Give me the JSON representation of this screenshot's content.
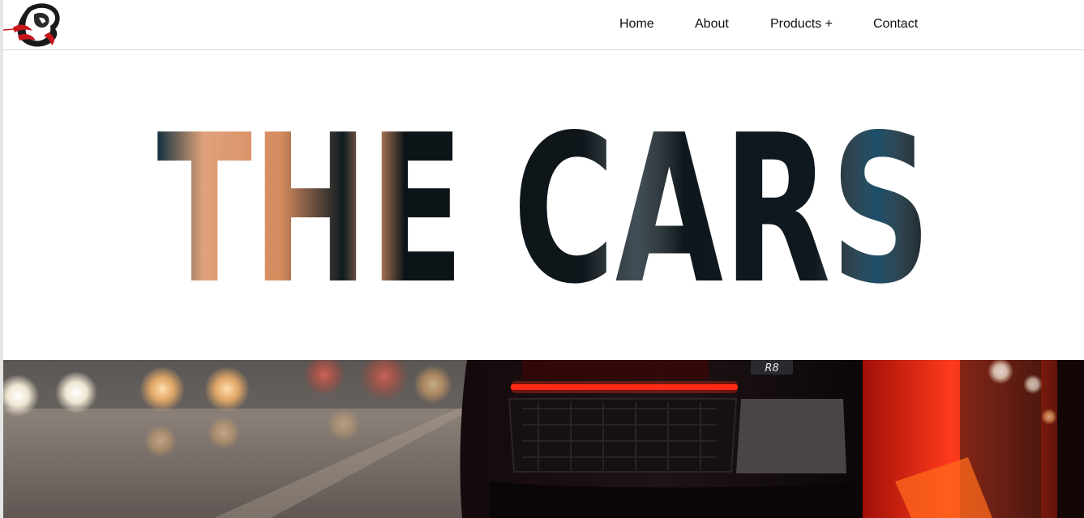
{
  "nav": {
    "items": [
      {
        "label": "Home"
      },
      {
        "label": "About"
      },
      {
        "label": "Products +"
      },
      {
        "label": "Contact"
      }
    ]
  },
  "hero": {
    "title": "THE CARS"
  },
  "banner": {
    "badge_text": "R8"
  },
  "colors": {
    "text": "#111111",
    "divider": "#d4d4d4",
    "hero_fill": "#0f1a20",
    "taillight": "#ff2a14"
  },
  "icons": {
    "logo": "lion-logo-icon"
  }
}
